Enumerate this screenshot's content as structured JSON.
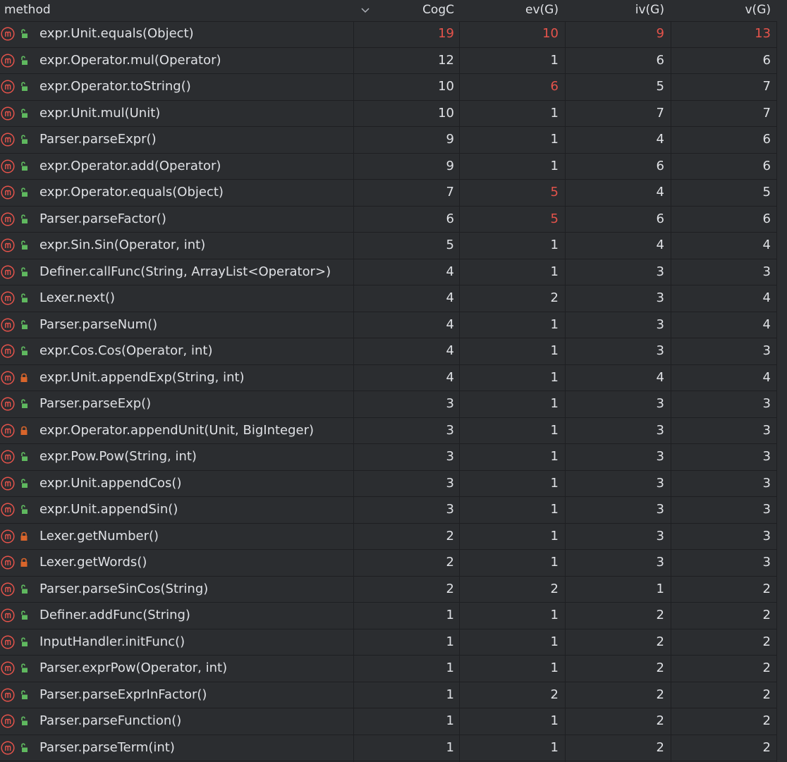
{
  "columns": {
    "method": "method",
    "cogc": "CogC",
    "evg": "ev(G)",
    "ivg": "iv(G)",
    "vg": "v(G)"
  },
  "colors": {
    "background": "#2b2d30",
    "text": "#dfe1e5",
    "highlight": "#e5534b",
    "method_icon": "#e5534b",
    "public_lock": "#5fb85f",
    "private_lock": "#d9652b"
  },
  "icons": {
    "method": "method-m-icon",
    "public": "unlocked-padlock-icon",
    "private": "locked-padlock-icon",
    "sort": "chevron-down-icon"
  },
  "rows": [
    {
      "name": "expr.Unit.equals(Object)",
      "access": "public",
      "cogc": "19",
      "evg": "10",
      "ivg": "9",
      "vg": "13",
      "hl": [
        true,
        true,
        true,
        true
      ]
    },
    {
      "name": "expr.Operator.mul(Operator)",
      "access": "public",
      "cogc": "12",
      "evg": "1",
      "ivg": "6",
      "vg": "6",
      "hl": [
        false,
        false,
        false,
        false
      ]
    },
    {
      "name": "expr.Operator.toString()",
      "access": "public",
      "cogc": "10",
      "evg": "6",
      "ivg": "5",
      "vg": "7",
      "hl": [
        false,
        true,
        false,
        false
      ]
    },
    {
      "name": "expr.Unit.mul(Unit)",
      "access": "public",
      "cogc": "10",
      "evg": "1",
      "ivg": "7",
      "vg": "7",
      "hl": [
        false,
        false,
        false,
        false
      ]
    },
    {
      "name": "Parser.parseExpr()",
      "access": "public",
      "cogc": "9",
      "evg": "1",
      "ivg": "4",
      "vg": "6",
      "hl": [
        false,
        false,
        false,
        false
      ]
    },
    {
      "name": "expr.Operator.add(Operator)",
      "access": "public",
      "cogc": "9",
      "evg": "1",
      "ivg": "6",
      "vg": "6",
      "hl": [
        false,
        false,
        false,
        false
      ]
    },
    {
      "name": "expr.Operator.equals(Object)",
      "access": "public",
      "cogc": "7",
      "evg": "5",
      "ivg": "4",
      "vg": "5",
      "hl": [
        false,
        true,
        false,
        false
      ]
    },
    {
      "name": "Parser.parseFactor()",
      "access": "public",
      "cogc": "6",
      "evg": "5",
      "ivg": "6",
      "vg": "6",
      "hl": [
        false,
        true,
        false,
        false
      ]
    },
    {
      "name": "expr.Sin.Sin(Operator, int)",
      "access": "public",
      "cogc": "5",
      "evg": "1",
      "ivg": "4",
      "vg": "4",
      "hl": [
        false,
        false,
        false,
        false
      ]
    },
    {
      "name": "Definer.callFunc(String, ArrayList<Operator>)",
      "access": "public",
      "cogc": "4",
      "evg": "1",
      "ivg": "3",
      "vg": "3",
      "hl": [
        false,
        false,
        false,
        false
      ]
    },
    {
      "name": "Lexer.next()",
      "access": "public",
      "cogc": "4",
      "evg": "2",
      "ivg": "3",
      "vg": "4",
      "hl": [
        false,
        false,
        false,
        false
      ]
    },
    {
      "name": "Parser.parseNum()",
      "access": "public",
      "cogc": "4",
      "evg": "1",
      "ivg": "3",
      "vg": "4",
      "hl": [
        false,
        false,
        false,
        false
      ]
    },
    {
      "name": "expr.Cos.Cos(Operator, int)",
      "access": "public",
      "cogc": "4",
      "evg": "1",
      "ivg": "3",
      "vg": "3",
      "hl": [
        false,
        false,
        false,
        false
      ]
    },
    {
      "name": "expr.Unit.appendExp(String, int)",
      "access": "private",
      "cogc": "4",
      "evg": "1",
      "ivg": "4",
      "vg": "4",
      "hl": [
        false,
        false,
        false,
        false
      ]
    },
    {
      "name": "Parser.parseExp()",
      "access": "public",
      "cogc": "3",
      "evg": "1",
      "ivg": "3",
      "vg": "3",
      "hl": [
        false,
        false,
        false,
        false
      ]
    },
    {
      "name": "expr.Operator.appendUnit(Unit, BigInteger)",
      "access": "private",
      "cogc": "3",
      "evg": "1",
      "ivg": "3",
      "vg": "3",
      "hl": [
        false,
        false,
        false,
        false
      ]
    },
    {
      "name": "expr.Pow.Pow(String, int)",
      "access": "public",
      "cogc": "3",
      "evg": "1",
      "ivg": "3",
      "vg": "3",
      "hl": [
        false,
        false,
        false,
        false
      ]
    },
    {
      "name": "expr.Unit.appendCos()",
      "access": "public",
      "cogc": "3",
      "evg": "1",
      "ivg": "3",
      "vg": "3",
      "hl": [
        false,
        false,
        false,
        false
      ]
    },
    {
      "name": "expr.Unit.appendSin()",
      "access": "public",
      "cogc": "3",
      "evg": "1",
      "ivg": "3",
      "vg": "3",
      "hl": [
        false,
        false,
        false,
        false
      ]
    },
    {
      "name": "Lexer.getNumber()",
      "access": "private",
      "cogc": "2",
      "evg": "1",
      "ivg": "3",
      "vg": "3",
      "hl": [
        false,
        false,
        false,
        false
      ]
    },
    {
      "name": "Lexer.getWords()",
      "access": "private",
      "cogc": "2",
      "evg": "1",
      "ivg": "3",
      "vg": "3",
      "hl": [
        false,
        false,
        false,
        false
      ]
    },
    {
      "name": "Parser.parseSinCos(String)",
      "access": "public",
      "cogc": "2",
      "evg": "2",
      "ivg": "1",
      "vg": "2",
      "hl": [
        false,
        false,
        false,
        false
      ]
    },
    {
      "name": "Definer.addFunc(String)",
      "access": "public",
      "cogc": "1",
      "evg": "1",
      "ivg": "2",
      "vg": "2",
      "hl": [
        false,
        false,
        false,
        false
      ]
    },
    {
      "name": "InputHandler.initFunc()",
      "access": "public",
      "cogc": "1",
      "evg": "1",
      "ivg": "2",
      "vg": "2",
      "hl": [
        false,
        false,
        false,
        false
      ]
    },
    {
      "name": "Parser.exprPow(Operator, int)",
      "access": "public",
      "cogc": "1",
      "evg": "1",
      "ivg": "2",
      "vg": "2",
      "hl": [
        false,
        false,
        false,
        false
      ]
    },
    {
      "name": "Parser.parseExprInFactor()",
      "access": "public",
      "cogc": "1",
      "evg": "2",
      "ivg": "2",
      "vg": "2",
      "hl": [
        false,
        false,
        false,
        false
      ]
    },
    {
      "name": "Parser.parseFunction()",
      "access": "public",
      "cogc": "1",
      "evg": "1",
      "ivg": "2",
      "vg": "2",
      "hl": [
        false,
        false,
        false,
        false
      ]
    },
    {
      "name": "Parser.parseTerm(int)",
      "access": "public",
      "cogc": "1",
      "evg": "1",
      "ivg": "2",
      "vg": "2",
      "hl": [
        false,
        false,
        false,
        false
      ]
    }
  ]
}
